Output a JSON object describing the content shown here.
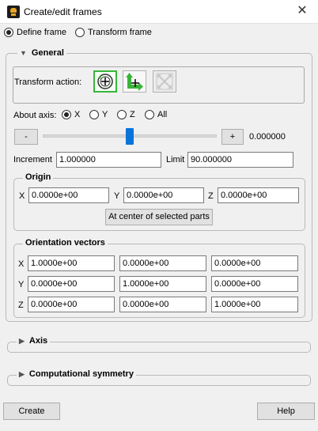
{
  "window": {
    "title": "Create/edit frames",
    "close_glyph": "✕"
  },
  "mode": {
    "define_label": "Define frame",
    "transform_label": "Transform frame",
    "selected": "define"
  },
  "general": {
    "title": "General",
    "transform_action_label": "Transform action:",
    "tools": [
      {
        "icon": "rotate-icon",
        "active": true
      },
      {
        "icon": "translate-icon",
        "active": false
      },
      {
        "icon": "scale-icon",
        "active": false,
        "disabled": true
      }
    ],
    "about_axis": {
      "label": "About axis:",
      "options": [
        "X",
        "Y",
        "Z",
        "All"
      ],
      "selected": "X"
    },
    "slider": {
      "minus": "-",
      "plus": "+",
      "value_text": "0.000000",
      "position": 0.5
    },
    "increment": {
      "label": "Increment",
      "value": "1.000000"
    },
    "limit": {
      "label": "Limit",
      "value": "90.000000"
    }
  },
  "origin": {
    "title": "Origin",
    "x_label": "X",
    "x": "0.0000e+00",
    "y_label": "Y",
    "y": "0.0000e+00",
    "z_label": "Z",
    "z": "0.0000e+00",
    "center_button": "At center of selected parts"
  },
  "orientation": {
    "title": "Orientation vectors",
    "row_labels": [
      "X",
      "Y",
      "Z"
    ],
    "rows": [
      [
        "1.0000e+00",
        "0.0000e+00",
        "0.0000e+00"
      ],
      [
        "0.0000e+00",
        "1.0000e+00",
        "0.0000e+00"
      ],
      [
        "0.0000e+00",
        "0.0000e+00",
        "1.0000e+00"
      ]
    ]
  },
  "axis_section": {
    "title": "Axis"
  },
  "symmetry_section": {
    "title": "Computational symmetry"
  },
  "footer": {
    "create": "Create",
    "help": "Help"
  },
  "colors": {
    "accent_green": "#3bb33b"
  }
}
